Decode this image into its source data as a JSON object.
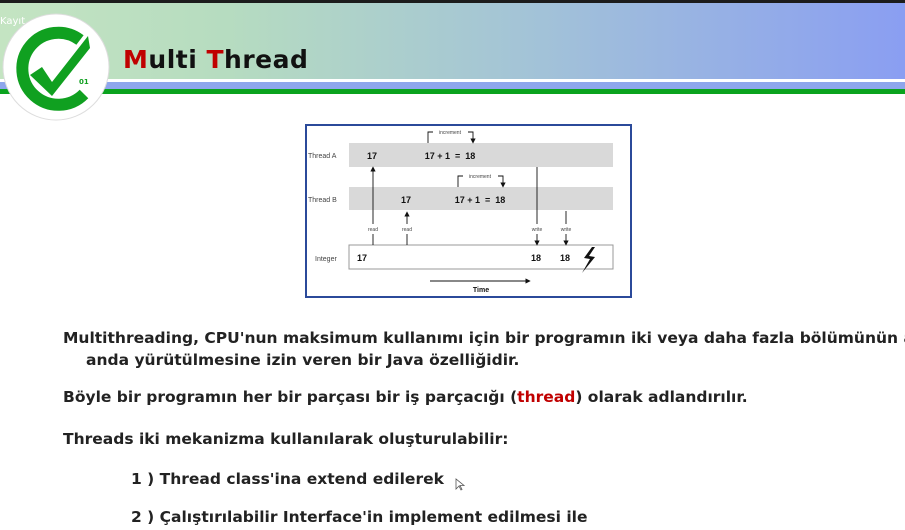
{
  "header": {
    "overlay_text": "Kayıt",
    "title_first_letter": "M",
    "title_rest1": "ulti ",
    "title_second_letter": "T",
    "title_rest2": "hread",
    "logo_text": "01"
  },
  "diagram": {
    "thread_a_label": "Thread A",
    "thread_b_label": "Thread B",
    "integer_label": "Integer",
    "a_read_value": "17",
    "a_increment": "17 + 1  =  18",
    "b_read_value": "17",
    "b_increment": "17 + 1  =  18",
    "increment_label": "increment",
    "read_label": "read",
    "write_label": "write",
    "int_initial": "17",
    "int_write1": "18",
    "int_write2": "18",
    "time_label": "Time"
  },
  "body": {
    "p1_line1": "Multithreading, CPU'nun maksimum kullanımı için bir programın iki veya daha fazla bölümünün aynı",
    "p1_line2": "anda yürütülmesine izin veren bir Java özelliğidir.",
    "p2_before": "Böyle bir programın her bir parçası bir iş parçacığı (",
    "p2_highlight": "thread",
    "p2_after": ") olarak adlandırılır.",
    "p3": "Threads iki mekanizma kullanılarak oluşturulabilir:",
    "item1": "1 ) Thread class'ina extend edilerek",
    "item2": "2 ) Çalıştırılabilir Interface'in implement edilmesi ile"
  },
  "colors": {
    "accent_red": "#c00000",
    "green": "#0aa31e",
    "diagram_border": "#2b4a9a"
  }
}
